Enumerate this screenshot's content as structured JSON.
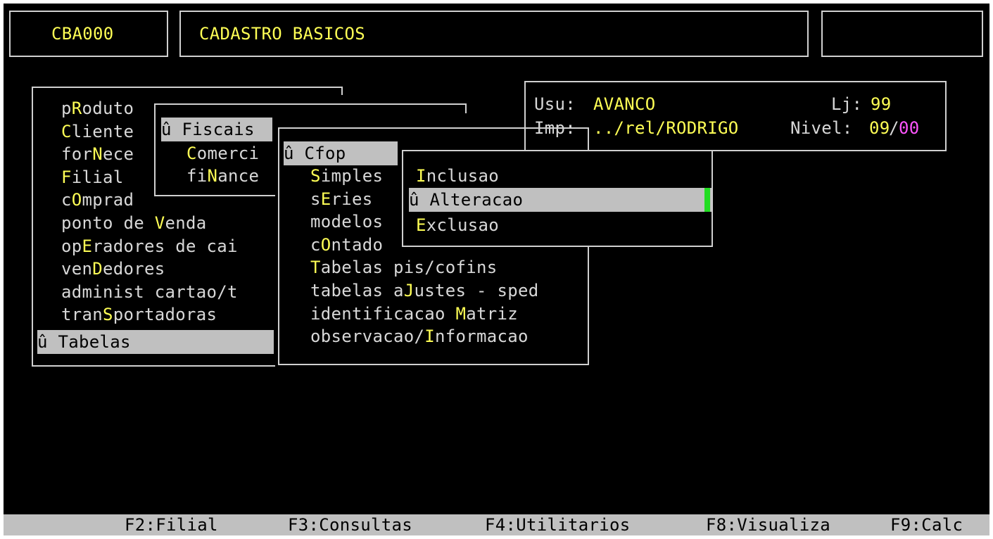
{
  "header": {
    "program_code": "CBA000",
    "program_title": "CADASTRO BASICOS"
  },
  "info_panel": {
    "usu_label": "Usu:",
    "usu_value": "AVANCO",
    "lj_label": "Lj:",
    "lj_value": "99",
    "imp_label": "Imp:",
    "imp_value": "../rel/RODRIGO",
    "nivel_label": "Nivel:",
    "nivel_value_a": "09",
    "nivel_sep": "/",
    "nivel_value_b": "00"
  },
  "main_menu": {
    "items": [
      {
        "pre": "p",
        "hot": "R",
        "post": "oduto"
      },
      {
        "pre": "",
        "hot": "C",
        "post": "liente"
      },
      {
        "pre": "for",
        "hot": "N",
        "post": "ece"
      },
      {
        "pre": "",
        "hot": "F",
        "post": "ilial"
      },
      {
        "pre": "c",
        "hot": "O",
        "post": "mprad"
      },
      {
        "pre": "ponto de ",
        "hot": "V",
        "post": "enda"
      },
      {
        "pre": "op",
        "hot": "E",
        "post": "radores de cai"
      },
      {
        "pre": "ven",
        "hot": "D",
        "post": "edores"
      },
      {
        "pre": "administ cartao/t",
        "hot": "",
        "post": ""
      },
      {
        "pre": "tran",
        "hot": "S",
        "post": "portadoras"
      }
    ],
    "selected": "û Tabelas"
  },
  "tabelas_menu": {
    "selected": "û Fiscais",
    "items": [
      {
        "pre": "",
        "hot": "C",
        "post": "omerci"
      },
      {
        "pre": "fi",
        "hot": "N",
        "post": "ance"
      }
    ]
  },
  "fiscais_menu": {
    "selected": "û Cfop",
    "items": [
      {
        "pre": "",
        "hot": "S",
        "post": "imples"
      },
      {
        "pre": "s",
        "hot": "E",
        "post": "ries"
      },
      {
        "pre": "modelos",
        "hot": "",
        "post": ""
      },
      {
        "pre": "c",
        "hot": "O",
        "post": "ntado"
      },
      {
        "pre": "",
        "hot": "T",
        "post": "abelas pis/cofins"
      },
      {
        "pre": "tabelas a",
        "hot": "J",
        "post": "ustes - sped"
      },
      {
        "pre": "identificacao ",
        "hot": "M",
        "post": "atriz"
      },
      {
        "pre": "observacao/",
        "hot": "I",
        "post": "nformacao"
      }
    ]
  },
  "cfop_menu": {
    "items": [
      {
        "pre": "",
        "hot": "I",
        "post": "nclusao"
      },
      {
        "pre": "",
        "hot": "E",
        "post": "xclusao"
      }
    ],
    "selected": "û Alteracao"
  },
  "function_keys": [
    "F2:Filial",
    "F3:Consultas",
    "F4:Utilitarios",
    "F8:Visualiza",
    "F9:Calc"
  ],
  "colors": {
    "background": "#000000",
    "text": "#d8d8d8",
    "highlight": "#ffff55",
    "selection": "#c0c0c0",
    "magenta": "#ff55ff",
    "cursor": "#22dd22"
  }
}
